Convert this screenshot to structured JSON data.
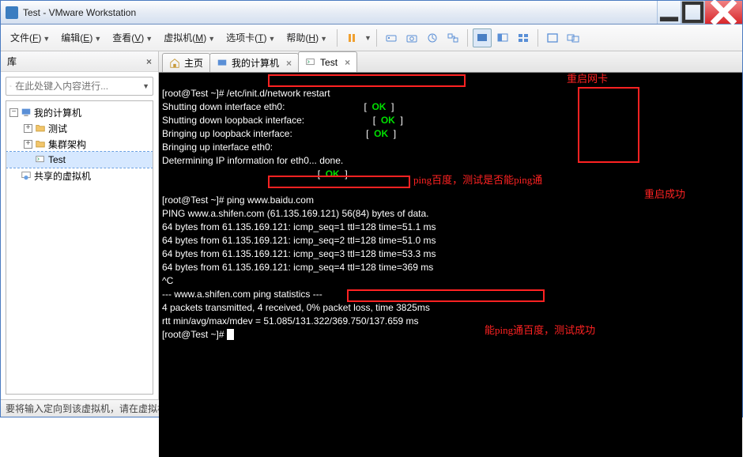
{
  "window": {
    "title": "Test - VMware Workstation"
  },
  "menu": {
    "file": "文件",
    "edit": "编辑",
    "view": "查看",
    "vm": "虚拟机",
    "tabs": "选项卡",
    "help": "帮助",
    "file_u": "F",
    "edit_u": "E",
    "view_u": "V",
    "vm_u": "M",
    "tabs_u": "T",
    "help_u": "H"
  },
  "sidebar": {
    "title": "库",
    "search_ph": "在此处键入内容进行...",
    "root": "我的计算机",
    "items": [
      "测试",
      "集群架构",
      "Test"
    ],
    "shared": "共享的虚拟机"
  },
  "tabs": [
    {
      "label": "主页"
    },
    {
      "label": "我的计算机"
    },
    {
      "label": "Test"
    }
  ],
  "term": {
    "l01": "[root@Test ~]# /etc/init.d/network restart",
    "l02": "Shutting down interface eth0:                              [  ",
    "l03": "Shutting down loopback interface:                          [  ",
    "l04": "Bringing up loopback interface:                            [  ",
    "l05": "Bringing up interface eth0:  ",
    "l06": "Determining IP information for eth0... done.",
    "l07": "                                                           [  ",
    "ok": "OK",
    "okpost": "  ]",
    "l08": "[root@Test ~]# ping www.baidu.com",
    "l09": "PING www.a.shifen.com (61.135.169.121) 56(84) bytes of data.",
    "l10": "64 bytes from 61.135.169.121: icmp_seq=1 ttl=128 time=51.1 ms",
    "l11": "64 bytes from 61.135.169.121: icmp_seq=2 ttl=128 time=51.0 ms",
    "l12": "64 bytes from 61.135.169.121: icmp_seq=3 ttl=128 time=53.3 ms",
    "l13": "64 bytes from 61.135.169.121: icmp_seq=4 ttl=128 time=369 ms",
    "l14": "^C",
    "l15": "--- www.a.shifen.com ping statistics ---",
    "l16": "4 packets transmitted, 4 received, 0% packet loss, time 3825ms",
    "l17": "rtt min/avg/max/mdev = 51.085/131.322/369.750/137.659 ms",
    "l18": "[root@Test ~]# "
  },
  "ann": {
    "a1": "重启网卡",
    "a2": "ping百度，测试是否能ping通",
    "a3": "重启成功",
    "a4": "能ping通百度，测试成功"
  },
  "status": "要将输入定向到该虚拟机，请在虚拟机内部单击或按 Ctrl+G。"
}
